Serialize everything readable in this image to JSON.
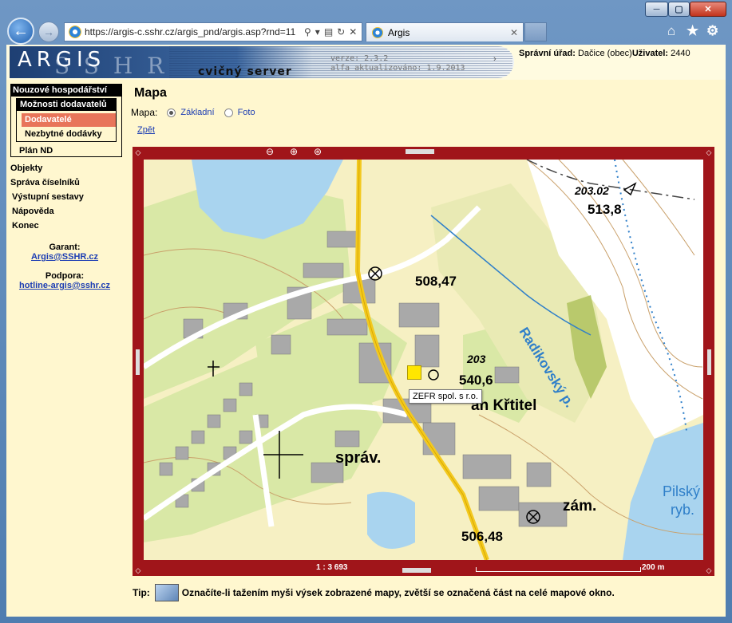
{
  "browser": {
    "url": "https://argis-c.sshr.cz/argis_pnd/argis.asp?rnd=11",
    "tab_title": "Argis",
    "window_controls": [
      "─",
      "▢",
      "✕"
    ]
  },
  "header": {
    "logo_argis": "ARGIS",
    "logo_sshr": "SSHR",
    "logo_subtitle": "cvičný server",
    "version": "verze: 2.3.2",
    "updated": "alfa aktualizováno: 1.9.2013",
    "office_label": "Správní úřad:",
    "office_value": "Dačice (obec)",
    "user_label": "Uživatel:",
    "user_value": "2440"
  },
  "sidebar": {
    "items": [
      {
        "label": "Nouzové hospodářství"
      },
      {
        "label": "Možnosti dodavatelů"
      },
      {
        "label": "Dodavatelé"
      },
      {
        "label": "Nezbytné dodávky"
      },
      {
        "label": "Plán ND"
      },
      {
        "label": "Objekty"
      },
      {
        "label": "Správa číselníků"
      },
      {
        "label": "Výstupní sestavy"
      },
      {
        "label": "Nápověda"
      },
      {
        "label": "Konec"
      }
    ],
    "guarantor_label": "Garant:",
    "guarantor_email": "Argis@SSHR.cz",
    "support_label": "Podpora:",
    "support_email": "hotline-argis@sshr.cz"
  },
  "main": {
    "title": "Mapa",
    "map_label": "Mapa:",
    "option_basic": "Základní",
    "option_photo": "Foto",
    "back_link": "Zpět",
    "scale": "1 : 3 693",
    "scale_bar": "200 m",
    "tooltip": "ZEFR spol. s r.o.",
    "tip_label": "Tip:",
    "tip_text": "Označíte-li tažením myši výsek zobrazené mapy, zvětší se označená část na celé mapové okno."
  },
  "map_labels": {
    "elev1": "203.02",
    "elev2": "513,8",
    "elev3": "508,47",
    "elev4": "203",
    "elev5": "540,6",
    "elev6": "506,48",
    "church": "an Křtitel",
    "admin": "správ.",
    "castle": "zám.",
    "river": "Radikovský p.",
    "pond": "Pilský",
    "pond2": "ryb."
  },
  "colors": {
    "map_frame": "#a0151a",
    "page_bg": "#fff7cf",
    "link": "#1c3db3",
    "selected_item": "#e8755a"
  }
}
